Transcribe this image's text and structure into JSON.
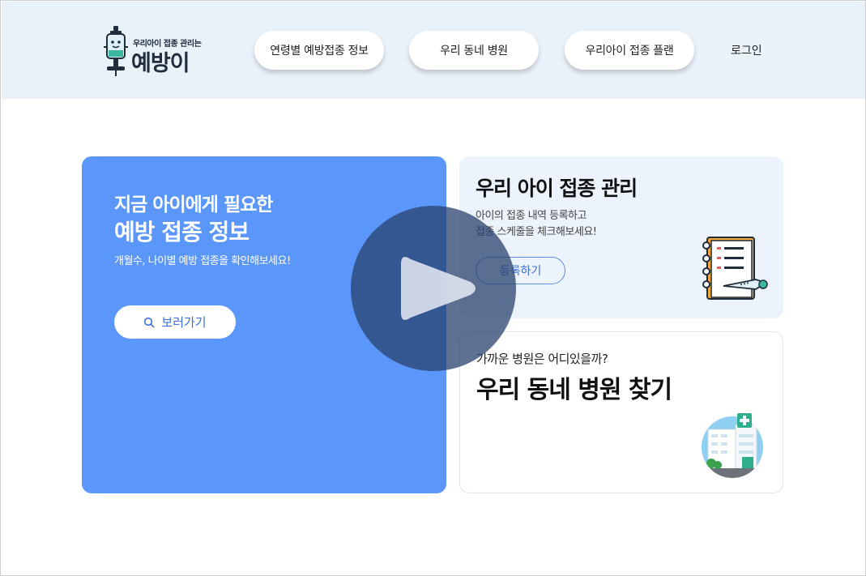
{
  "header": {
    "logo": {
      "tagline": "우리아이 접종 관리는",
      "name": "예방이"
    },
    "nav": [
      {
        "label": "연령별 예방접종 정보"
      },
      {
        "label": "우리 동네 병원"
      },
      {
        "label": "우리아이 접종 플랜"
      }
    ],
    "login_label": "로그인"
  },
  "main": {
    "info_card": {
      "title_line1": "지금 아이에게 필요한",
      "title_line2": "예방 접종 정보",
      "description": "개월수, 나이별 예방 접종을 확인해보세요!",
      "button_label": "보러가기",
      "button_icon": "search-icon",
      "background_color": "#5b97fb"
    },
    "management_card": {
      "title": "우리 아이 접종 관리",
      "description_line1": "아이의 접종 내역 등록하고",
      "description_line2": "접종 스케줄을 체크해보세요!",
      "button_label": "등록하기",
      "illustration": "notebook-icon"
    },
    "hospital_card": {
      "subtitle": "가까운 병원은 어디있을까?",
      "title": "우리 동네 병원 찾기",
      "illustration": "hospital-icon"
    }
  },
  "overlay": {
    "icon": "play-icon"
  },
  "colors": {
    "header_bg": "#e9f1f9",
    "accent_blue": "#5b97fb",
    "card_light_bg": "#edf3fc"
  }
}
